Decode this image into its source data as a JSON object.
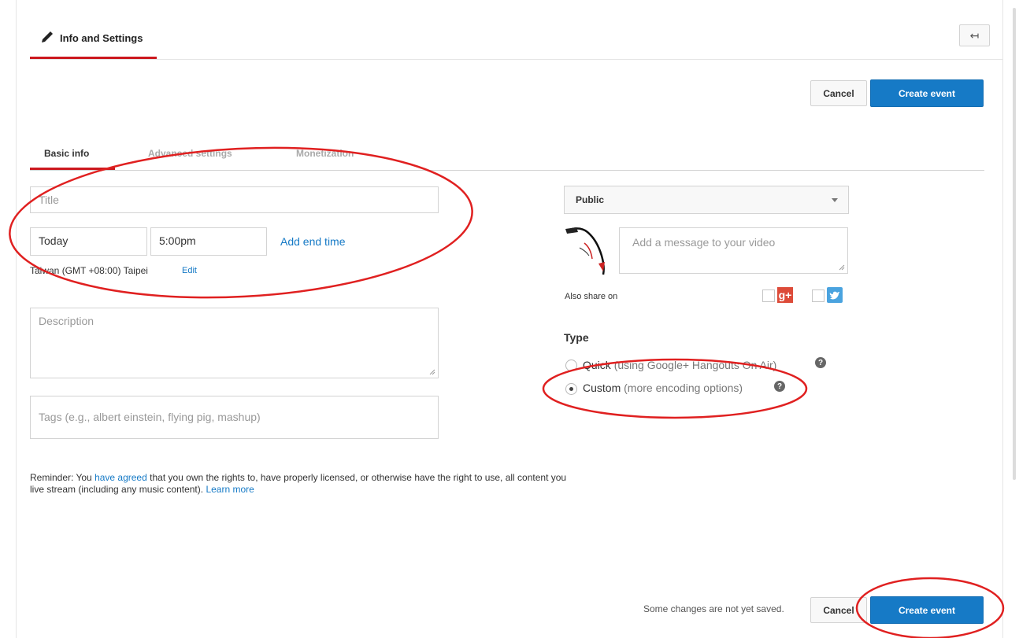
{
  "header": {
    "title": "Info and Settings",
    "back_icon": "↤"
  },
  "actions": {
    "cancel": "Cancel",
    "create": "Create event",
    "unsaved": "Some changes are not yet saved."
  },
  "tabs": [
    "Basic info",
    "Advanced settings",
    "Monetization"
  ],
  "form": {
    "title_placeholder": "Title",
    "date": "Today",
    "time": "5:00pm",
    "add_end_time": "Add end time",
    "timezone": "Taiwan (GMT +08:00) Taipei",
    "edit": "Edit",
    "description_placeholder": "Description",
    "tags_placeholder": "Tags (e.g., albert einstein, flying pig, mashup)"
  },
  "reminder": {
    "pre": "Reminder: You ",
    "link1": "have agreed",
    "mid": " that you own the rights to, have properly licensed, or otherwise have the right to use, all content you live stream (including any music content). ",
    "link2": "Learn more"
  },
  "privacy": {
    "selected": "Public"
  },
  "share": {
    "message_placeholder": "Add a message to your video",
    "also_share": "Also share on",
    "gplus_icon": "g+",
    "twitter_icon": "twitter"
  },
  "type": {
    "heading": "Type",
    "quick_label": "Quick",
    "quick_desc": "(using Google+ Hangouts On Air)",
    "custom_label": "Custom",
    "custom_desc": "(more encoding options)",
    "help_glyph": "?"
  },
  "colors": {
    "accent_red": "#cc181e",
    "button_blue": "#167ac6",
    "annotation_red": "#e02020"
  }
}
